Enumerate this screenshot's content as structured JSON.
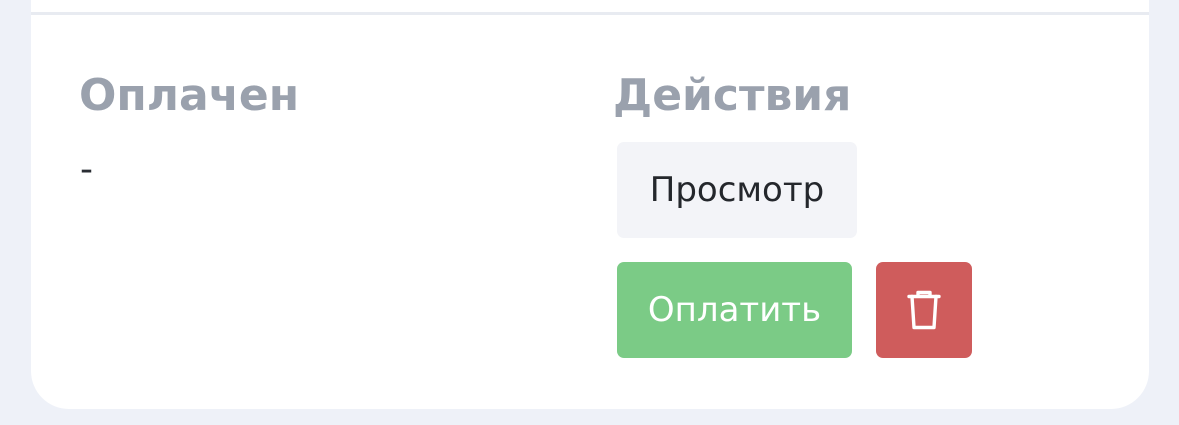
{
  "columns": {
    "paid": {
      "label": "Оплачен",
      "value": "-"
    },
    "actions": {
      "label": "Действия"
    }
  },
  "buttons": {
    "view_label": "Просмотр",
    "pay_label": "Оплатить",
    "delete_icon": "trash-icon"
  },
  "colors": {
    "background": "#eef1f8",
    "card": "#ffffff",
    "label": "#9aa1ad",
    "view_button": "#f3f4f8",
    "pay_button": "#7bcb86",
    "delete_button": "#cf5c5c"
  }
}
